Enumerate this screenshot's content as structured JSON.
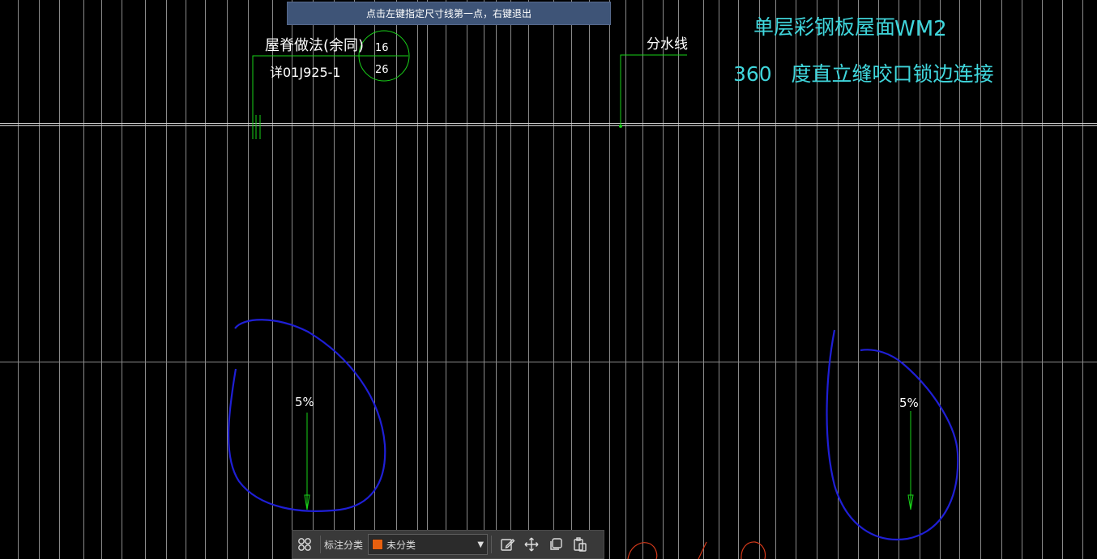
{
  "prompt": {
    "text": "点击左键指定尺寸线第一点，右键退出"
  },
  "drawing": {
    "ridge_note": "屋脊做法(余同)",
    "detail_ref": "详01J925-1",
    "callout_top": "16",
    "callout_bottom": "26",
    "divide_line": "分水线",
    "roof_title": "单层彩钢板屋面",
    "roof_code": "WM2",
    "seam_spec": "360   度直立缝咬口锁边连接",
    "slope_left": "5%",
    "slope_right": "5%"
  },
  "toolbar": {
    "category_label": "标注分类",
    "category_value": "未分类",
    "category_color": "#e8600f",
    "icons": [
      "grid-icon",
      "edit-icon",
      "move-icon",
      "copy-icon",
      "paste-icon"
    ]
  },
  "colors": {
    "cad_green": "#19d219",
    "cad_cyan": "#3fd6dc",
    "annotation_blue": "#1f1fd6",
    "annotation_red": "#d63a1a",
    "prompt_bg": "#3e5477"
  }
}
